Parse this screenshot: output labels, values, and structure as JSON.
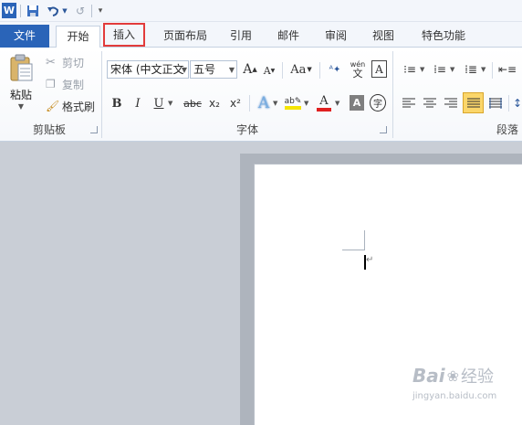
{
  "quick_access": {
    "app_icon": "word-icon",
    "save_icon": "save-icon",
    "undo_icon": "undo-icon",
    "redo_icon": "redo-icon",
    "customize_icon": "customize-qat-icon"
  },
  "tabs": [
    {
      "label": "文件"
    },
    {
      "label": "开始"
    },
    {
      "label": "插入"
    },
    {
      "label": "页面布局"
    },
    {
      "label": "引用"
    },
    {
      "label": "邮件"
    },
    {
      "label": "审阅"
    },
    {
      "label": "视图"
    },
    {
      "label": "特色功能"
    }
  ],
  "clipboard": {
    "paste": "粘贴",
    "cut": "剪切",
    "copy": "复制",
    "format_painter": "格式刷",
    "group_label": "剪贴板"
  },
  "font": {
    "font_name": "宋体 (中文正文",
    "font_size": "五号",
    "grow": "A",
    "shrink": "A",
    "change_case": "Aa",
    "bold": "B",
    "italic": "I",
    "underline": "U",
    "strike": "abc",
    "subscript": "x₂",
    "superscript": "x²",
    "group_label": "字体"
  },
  "paragraph": {
    "group_label": "段落"
  },
  "colors": {
    "file_tab": "#2a64b8",
    "highlight": "#e23b3b",
    "font_color": "#e02020",
    "highlighter": "#f5e400",
    "justify_active": "#fbd66a"
  },
  "watermark": {
    "line1": "Bai",
    "line2": "经验",
    "line3": "jingyan.baidu.com"
  }
}
